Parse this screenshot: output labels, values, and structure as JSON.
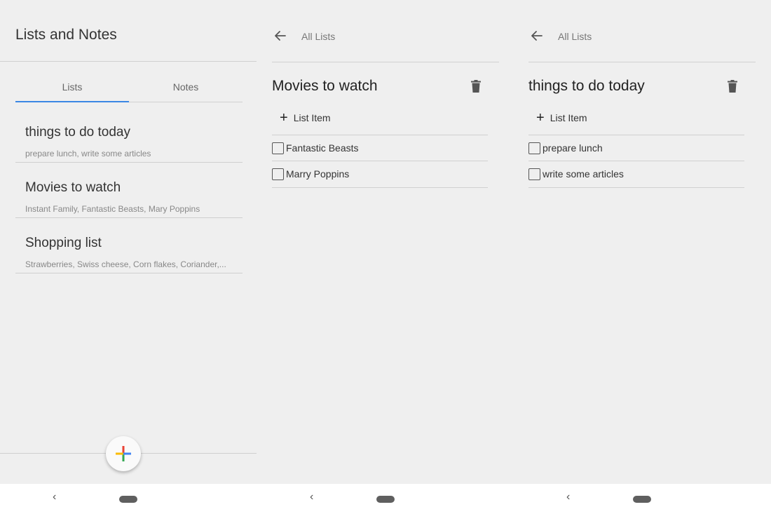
{
  "screen1": {
    "title": "Lists and Notes",
    "tabs": [
      {
        "label": "Lists",
        "active": true
      },
      {
        "label": "Notes",
        "active": false
      }
    ],
    "lists": [
      {
        "title": "things to do today",
        "subtitle": "prepare lunch, write some articles"
      },
      {
        "title": "Movies to watch",
        "subtitle": "Instant Family, Fantastic Beasts, Mary Poppins"
      },
      {
        "title": "Shopping list",
        "subtitle": "Strawberries, Swiss cheese, Corn flakes, Coriander,..."
      }
    ],
    "fab_icon": "plus-icon"
  },
  "screen2": {
    "back_label": "All Lists",
    "title": "Movies to watch",
    "add_label": "List Item",
    "items": [
      {
        "label": "Fantastic Beasts",
        "checked": false
      },
      {
        "label": "Marry Poppins",
        "checked": false
      }
    ]
  },
  "screen3": {
    "back_label": "All Lists",
    "title": "things to do today",
    "add_label": "List Item",
    "items": [
      {
        "label": "prepare lunch",
        "checked": false
      },
      {
        "label": "write some articles",
        "checked": false
      }
    ]
  },
  "navbar": {
    "back_glyph": "‹",
    "accent": "#3b87e4"
  }
}
